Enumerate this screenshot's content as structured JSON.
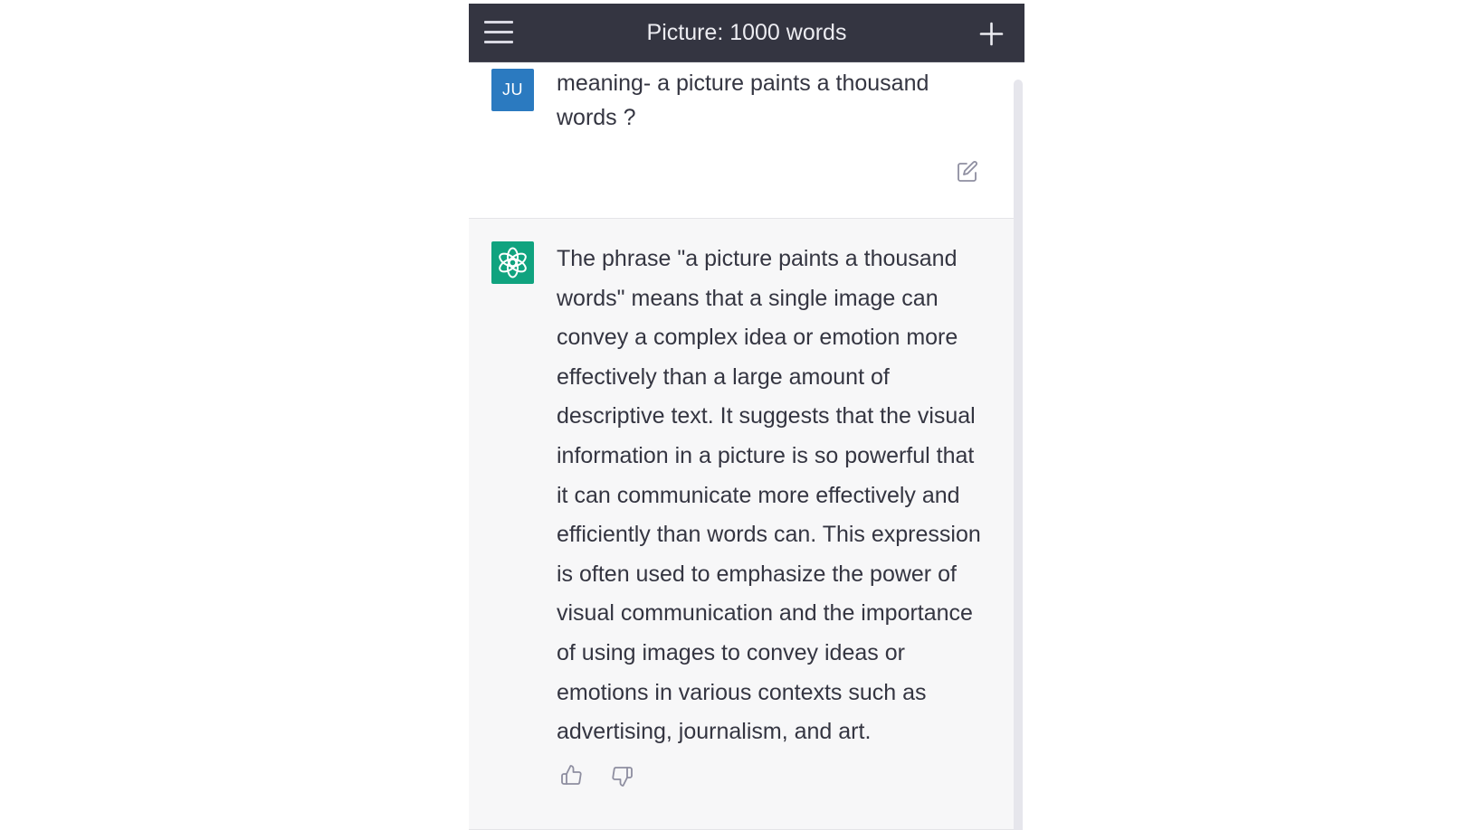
{
  "header": {
    "title": "Picture: 1000 words",
    "menu_icon": "hamburger-menu-icon",
    "new_chat_icon": "plus-icon"
  },
  "conversation": {
    "user_message": {
      "avatar_initials": "JU",
      "avatar_color": "#2b7ac0",
      "text": "meaning- a picture paints a thousand words ?",
      "edit_icon": "edit-icon"
    },
    "assistant_message": {
      "avatar_icon": "openai-logo-icon",
      "avatar_color": "#10a37f",
      "text": "The phrase \"a picture paints a thousand words\" means that a single image can convey a complex idea or emotion more effectively than a large amount of descriptive text. It suggests that the visual information in a picture is so powerful that it can communicate more effectively and efficiently than words can. This expression is often used to emphasize the power of visual communication and the importance of using images to convey ideas or emotions in various contexts such as advertising, journalism, and art.",
      "thumbs_up_icon": "thumbs-up-icon",
      "thumbs_down_icon": "thumbs-down-icon"
    }
  },
  "colors": {
    "header_bg": "#343541",
    "assistant_bg": "#f7f7f8",
    "text": "#343541"
  }
}
